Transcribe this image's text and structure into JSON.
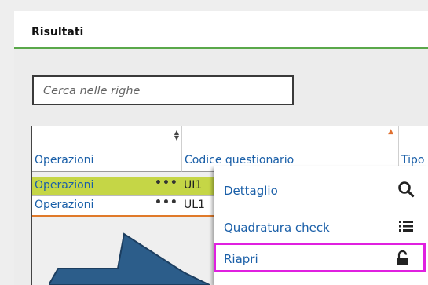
{
  "header": {
    "title": "Risultati"
  },
  "search": {
    "placeholder": "Cerca nelle righe"
  },
  "table": {
    "columns": [
      "Operazioni",
      "Codice questionario",
      "Tipo Isti"
    ],
    "rows": [
      {
        "ops": "Operazioni",
        "more": "•••",
        "code": "UI1",
        "selected": true
      },
      {
        "ops": "Operazioni",
        "more": "•••",
        "code": "UL1",
        "selected": false
      }
    ]
  },
  "context_menu": {
    "items": [
      {
        "label": "Dettaglio",
        "icon": "search-icon"
      },
      {
        "label": "Quadratura check",
        "icon": "list-icon"
      },
      {
        "label": "Riapri",
        "icon": "unlock-icon",
        "highlighted": true
      }
    ]
  },
  "colors": {
    "selected_row": "#c5d646",
    "link": "#1a5fa8",
    "header_border": "#5aa84a",
    "highlight_border": "#e020e0",
    "arrow": "#2c5d8a"
  }
}
